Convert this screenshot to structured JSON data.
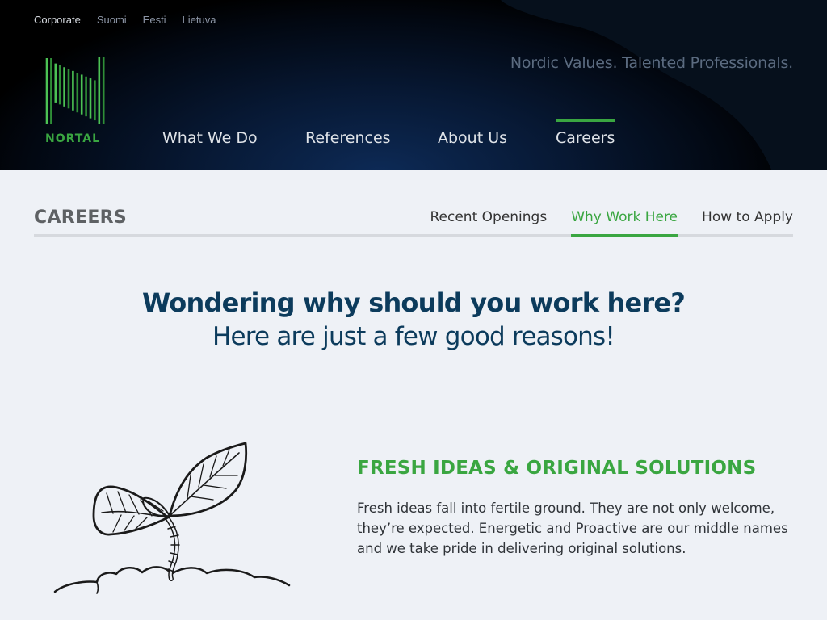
{
  "languages": [
    {
      "label": "Corporate",
      "active": true
    },
    {
      "label": "Suomi"
    },
    {
      "label": "Eesti"
    },
    {
      "label": "Lietuva"
    }
  ],
  "logo": {
    "wordmark": "NORTAL",
    "icon": "nortal-n-logo-icon"
  },
  "tagline": "Nordic Values. Talented Professionals.",
  "main_nav": [
    {
      "label": "What We Do"
    },
    {
      "label": "References"
    },
    {
      "label": "About Us"
    },
    {
      "label": "Careers",
      "active": true
    }
  ],
  "section": {
    "title": "CAREERS"
  },
  "sub_nav": [
    {
      "label": "Recent Openings"
    },
    {
      "label": "Why Work Here",
      "active": true
    },
    {
      "label": "How to Apply"
    }
  ],
  "hero": {
    "title": "Wondering why should you work here?",
    "subtitle": "Here are just a few good reasons!"
  },
  "feature": {
    "title": "FRESH IDEAS & ORIGINAL SOLUTIONS",
    "text": "Fresh ideas fall into fertile ground. They are not only welcome, they’re expected. Energetic and Proactive are our middle names and we take pride in delivering original solutions.",
    "icon": "sprout-illustration-icon"
  },
  "colors": {
    "accent_green": "#3aa641",
    "heading_navy": "#0c3b5c",
    "page_bg": "#eef1f6",
    "header_bg": "#020710"
  }
}
